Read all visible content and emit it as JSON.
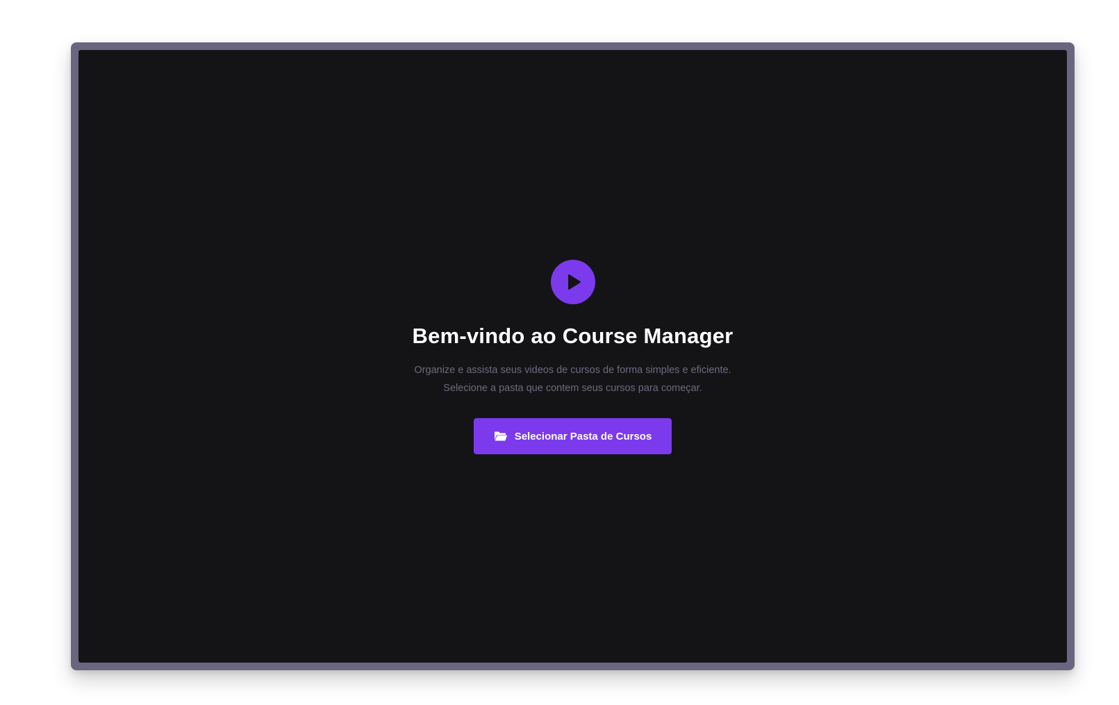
{
  "welcome": {
    "logo_icon": "play-icon",
    "title": "Bem-vindo ao Course Manager",
    "description_line1": "Organize e assista seus videos de cursos de forma simples e eficiente.",
    "description_line2": "Selecione a pasta que contem seus cursos para começar.",
    "button_icon": "folder-open-icon",
    "button_label": "Selecionar Pasta de Cursos"
  },
  "colors": {
    "accent": "#7c3aed",
    "background": "#141417",
    "frame": "#6b6680",
    "muted_text": "#6b6b80"
  }
}
